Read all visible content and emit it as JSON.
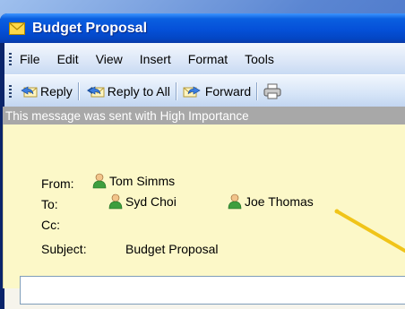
{
  "window": {
    "title": "Budget Proposal"
  },
  "menu": {
    "items": [
      "File",
      "Edit",
      "View",
      "Insert",
      "Format",
      "Tools"
    ]
  },
  "toolbar": {
    "reply": "Reply",
    "reply_all": "Reply to All",
    "forward": "Forward"
  },
  "importance_banner": "This message was sent with High Importance",
  "headers": {
    "from_label": "From:",
    "to_label": "To:",
    "cc_label": "Cc:",
    "subject_label": "Subject:",
    "from": "Tom Simms",
    "to": [
      "Syd Choi",
      "Joe Thomas"
    ],
    "subject": "Budget Proposal"
  },
  "colors": {
    "titlebar": "#0550d8",
    "header_bg": "#fcf8c8",
    "banner_bg": "#a8a8a8",
    "annotation_arrow": "#f0c419"
  },
  "icons": [
    "envelope-icon",
    "reply-icon",
    "reply-all-icon",
    "forward-icon",
    "print-icon",
    "contact-icon"
  ]
}
